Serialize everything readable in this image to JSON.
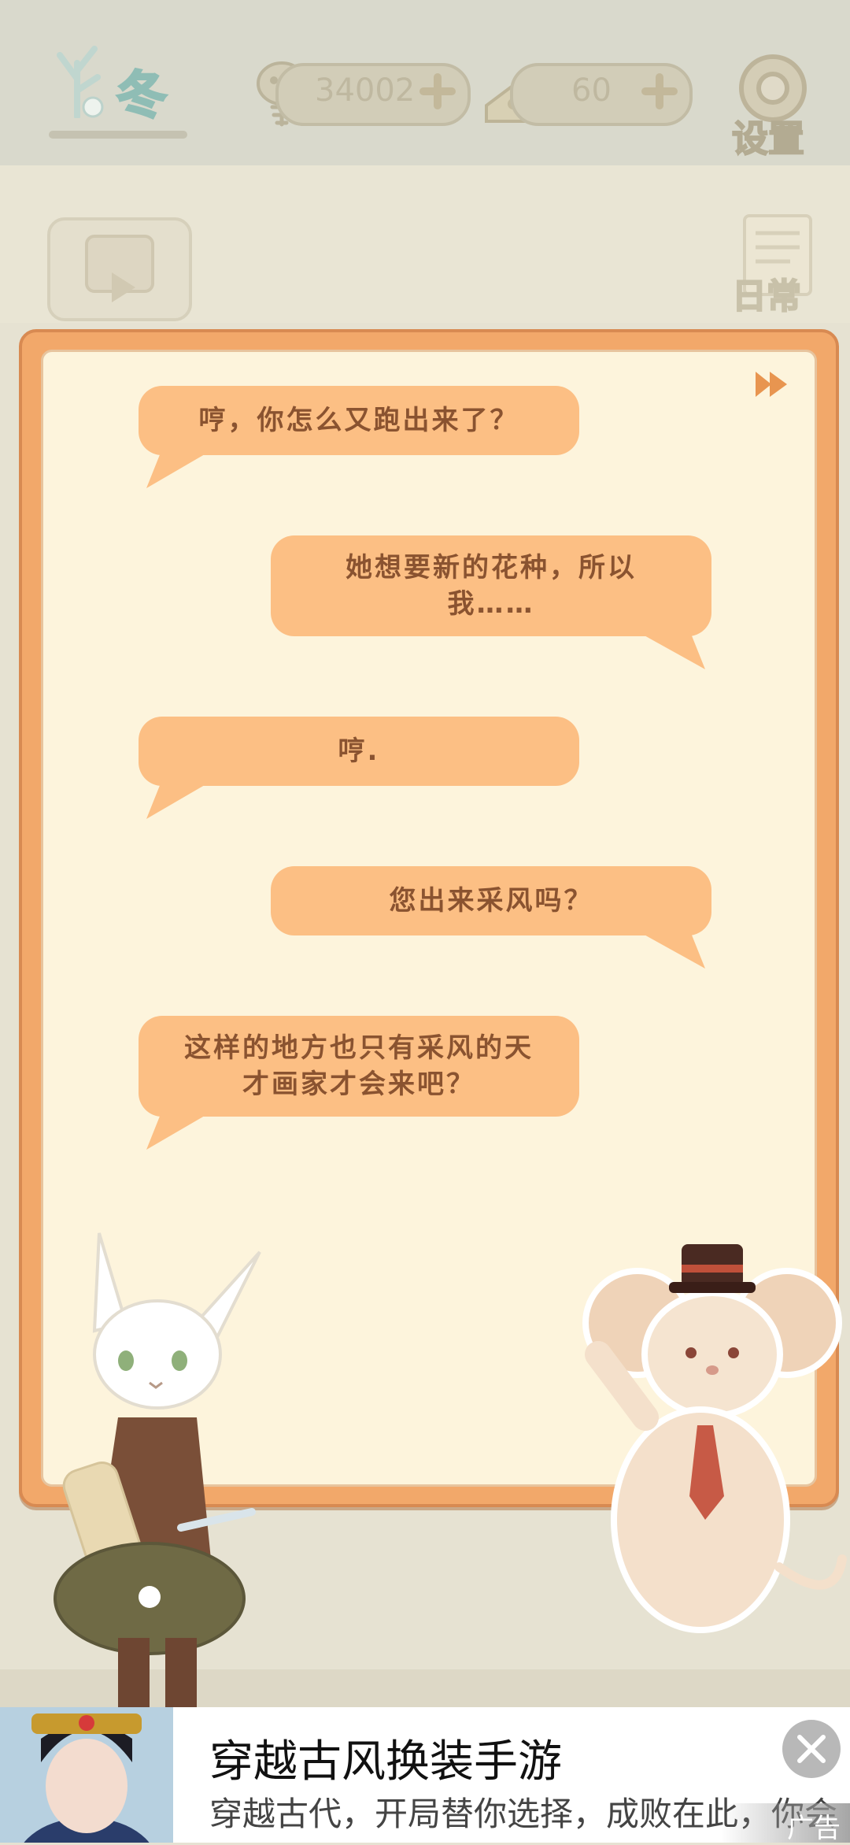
{
  "header": {
    "season_label": "冬",
    "fish_count": "34002",
    "cheese_count": "60",
    "settings_label": "设置"
  },
  "side": {
    "daily_label": "日常"
  },
  "dialog": {
    "lines": [
      {
        "speaker": "left",
        "text": "哼，你怎么又跑出来了？"
      },
      {
        "speaker": "right",
        "text": "她想要新的花种，所以我……"
      },
      {
        "speaker": "left",
        "text": "哼."
      },
      {
        "speaker": "right",
        "text": "您出来采风吗？"
      },
      {
        "speaker": "left",
        "text": "这样的地方也只有采风的天才画家才会来吧？"
      }
    ]
  },
  "ad": {
    "title": "穿越古风换装手游",
    "description": "穿越古代，开局替你选择，成败在此，你会",
    "badge": "广告"
  },
  "colors": {
    "bubble": "#fcbf84",
    "bubble_text": "#8a5330",
    "panel_border": "#f2a86a",
    "panel_fill": "#fdf4dc"
  }
}
